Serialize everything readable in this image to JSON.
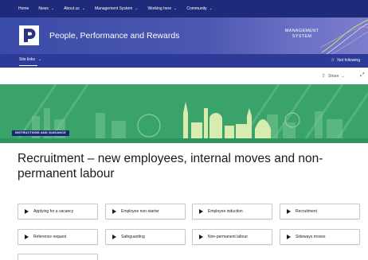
{
  "topnav": {
    "items": [
      {
        "label": "Home",
        "has_menu": false
      },
      {
        "label": "News",
        "has_menu": true
      },
      {
        "label": "About us",
        "has_menu": true
      },
      {
        "label": "Management System",
        "has_menu": true
      },
      {
        "label": "Working here",
        "has_menu": true
      },
      {
        "label": "Community",
        "has_menu": true
      }
    ]
  },
  "header": {
    "logo_letter": "p",
    "site_title": "People, Performance and Rewards",
    "badge_line1": "MANAGEMENT",
    "badge_line2": "SYSTEM"
  },
  "sitebar": {
    "site_links_label": "Site links",
    "follow_label": "Not following"
  },
  "actions": {
    "share_label": "Share"
  },
  "banner": {
    "tag": "INSTRUCTIONS AND GUIDANCE"
  },
  "page": {
    "title": "Recruitment – new employees, internal moves and non-permanent labour"
  },
  "quick_links": [
    "Applying for a vacancy",
    "Employee non-starter",
    "Employee induction",
    "Recruitment",
    "Reference request",
    "Safeguarding",
    "Non-permanent labour",
    "Sideways moves",
    ""
  ],
  "colors": {
    "nav": "#1e2a7a",
    "header": "#3a4ca8",
    "sitebar": "#2c3a98",
    "banner_green": "#3aa36a",
    "tag_bg": "#1b2770"
  }
}
